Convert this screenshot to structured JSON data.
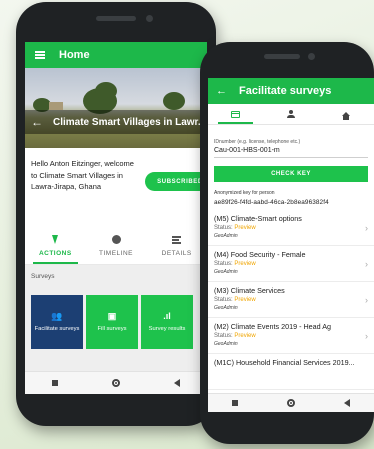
{
  "phone1": {
    "appbar_title": "Home",
    "banner_title": "Climate Smart Villages in Lawr...",
    "welcome_text": "Hello Anton Eitzinger, welcome to Climate Smart Villages in Lawra-Jirapa, Ghana",
    "subscribe_label": "SUBSCRIBED",
    "tabs": [
      {
        "label": "ACTIONS",
        "icon": "bolt-icon",
        "active": true
      },
      {
        "label": "TIMELINE",
        "icon": "clock-icon",
        "active": false
      },
      {
        "label": "DETAILS",
        "icon": "list-icon",
        "active": false
      }
    ],
    "surveys_label": "Surveys",
    "tiles": [
      {
        "label": "Facilitate surveys",
        "icon": "group-icon",
        "color": "#1c3f73"
      },
      {
        "label": "Fill surveys",
        "icon": "clipboard-icon",
        "color": "#1ec24c"
      },
      {
        "label": "Survey results",
        "icon": "bar-chart-icon",
        "color": "#1ec24c"
      }
    ]
  },
  "phone2": {
    "appbar_title": "Facilitate surveys",
    "id_label": "IDnumber (e.g. license, telephone etc.)",
    "id_value": "Cau-001-HBS-001-m",
    "check_key_label": "CHECK KEY",
    "key_label": "Anonymized key for person",
    "key_value": "ae89f26-f4fd-aabd-46ca-2b8ea96382f4",
    "surveys": [
      {
        "name": "(M5) Climate-Smart options",
        "status_label": "Status:",
        "status": "Preview",
        "author": "GeoAdmin"
      },
      {
        "name": "(M4) Food Security - Female",
        "status_label": "Status:",
        "status": "Preview",
        "author": "GeoAdmin"
      },
      {
        "name": "(M3) Climate Services",
        "status_label": "Status:",
        "status": "Preview",
        "author": "GeoAdmin"
      },
      {
        "name": "(M2) Climate Events 2019 - Head Ag",
        "status_label": "Status:",
        "status": "Preview",
        "author": "GeoAdmin"
      },
      {
        "name": "(M1C) Household Financial Services 2019...",
        "status_label": "",
        "status": "",
        "author": ""
      }
    ]
  },
  "colors": {
    "primary_green": "#1db84a",
    "navy_tile": "#1c3f73",
    "preview_orange": "#f0a500"
  }
}
